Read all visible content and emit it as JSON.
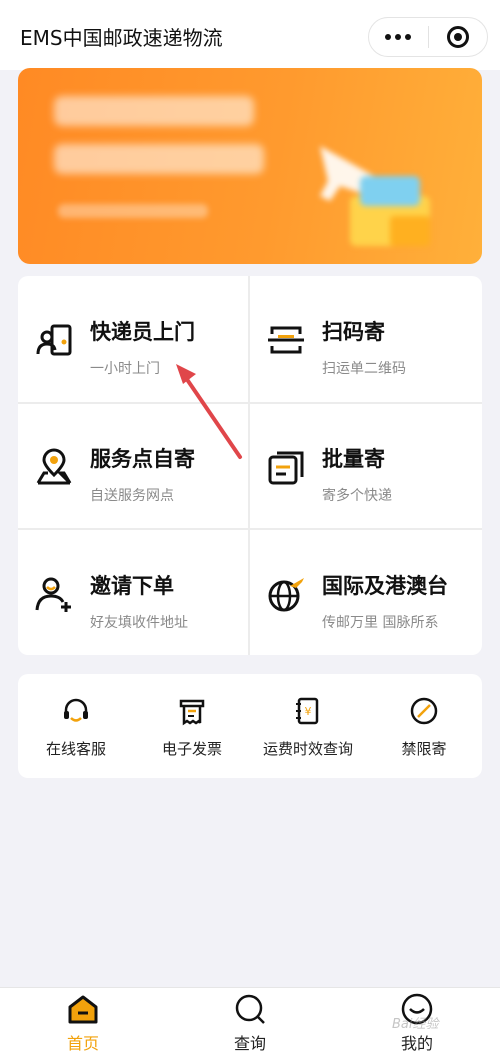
{
  "app": {
    "title": "EMS中国邮政速递物流"
  },
  "capsule": {
    "more_icon": "more-dots-icon",
    "close_icon": "target-circle-icon"
  },
  "banner": {
    "description_hidden": true
  },
  "services": [
    {
      "title": "快递员上门",
      "subtitle": "一小时上门",
      "icon": "courier-door-icon"
    },
    {
      "title": "扫码寄",
      "subtitle": "扫运单二维码",
      "icon": "scan-box-icon"
    },
    {
      "title": "服务点自寄",
      "subtitle": "自送服务网点",
      "icon": "location-pin-icon"
    },
    {
      "title": "批量寄",
      "subtitle": "寄多个快递",
      "icon": "stacked-cards-icon"
    },
    {
      "title": "邀请下单",
      "subtitle": "好友填收件地址",
      "icon": "person-add-icon"
    },
    {
      "title": "国际及港澳台",
      "subtitle": "传邮万里 国脉所系",
      "icon": "globe-plane-icon"
    }
  ],
  "tools": [
    {
      "label": "在线客服",
      "icon": "headset-icon"
    },
    {
      "label": "电子发票",
      "icon": "receipt-icon"
    },
    {
      "label": "运费时效查询",
      "icon": "yen-document-icon"
    },
    {
      "label": "禁限寄",
      "icon": "prohibited-icon"
    }
  ],
  "tabbar": [
    {
      "label": "首页",
      "icon": "home-icon",
      "active": true
    },
    {
      "label": "查询",
      "icon": "search-icon",
      "active": false
    },
    {
      "label": "我的",
      "icon": "profile-icon",
      "active": false
    }
  ],
  "watermark": {
    "text": "Bai经验"
  },
  "colors": {
    "accent": "#f2a20c",
    "banner": "#ff8a24",
    "annotation_arrow": "#e0464a"
  }
}
